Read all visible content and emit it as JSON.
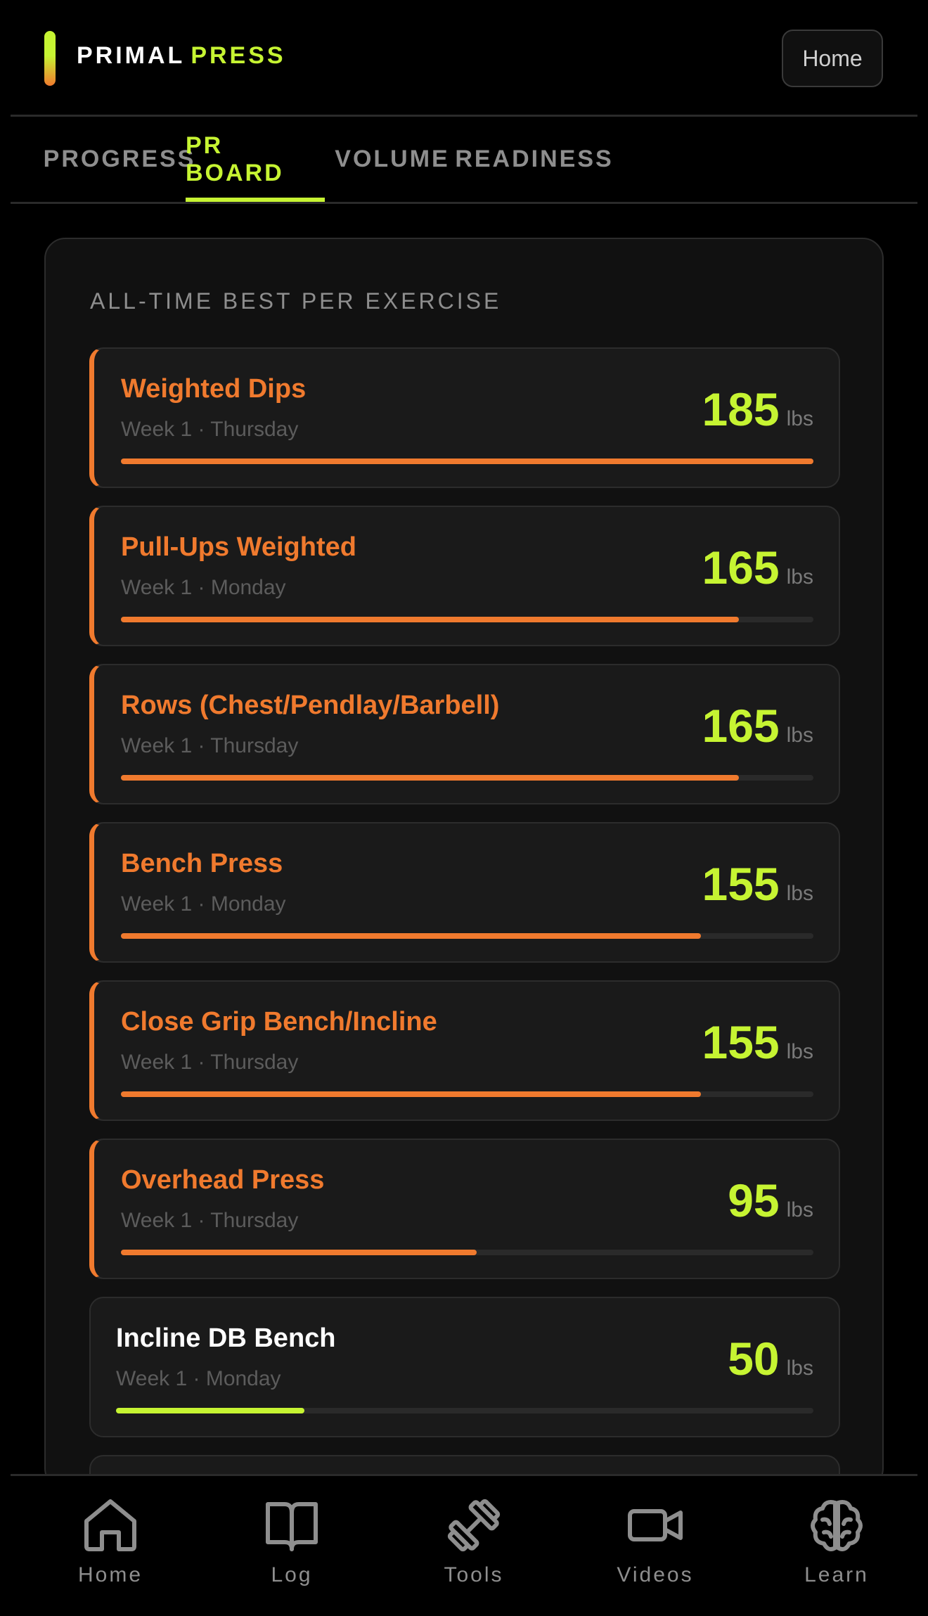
{
  "header": {
    "brand_word1": "PRIMAL",
    "brand_word2": "PRESS",
    "home_button": "Home"
  },
  "tabs": [
    {
      "label": "PROGRESS",
      "active": false
    },
    {
      "label": "PR BOARD",
      "active": true
    },
    {
      "label": "VOLUME",
      "active": false
    },
    {
      "label": "READINESS",
      "active": false
    }
  ],
  "board": {
    "title": "ALL-TIME BEST PER EXERCISE",
    "items": [
      {
        "name": "Weighted Dips",
        "meta": "Week 1 · Thursday",
        "value": "185",
        "unit": "lbs",
        "progress": 1.0,
        "highlight": true
      },
      {
        "name": "Pull-Ups Weighted",
        "meta": "Week 1 · Monday",
        "value": "165",
        "unit": "lbs",
        "progress": 0.892,
        "highlight": true
      },
      {
        "name": "Rows (Chest/Pendlay/Barbell)",
        "meta": "Week 1 · Thursday",
        "value": "165",
        "unit": "lbs",
        "progress": 0.892,
        "highlight": true
      },
      {
        "name": "Bench Press",
        "meta": "Week 1 · Monday",
        "value": "155",
        "unit": "lbs",
        "progress": 0.838,
        "highlight": true
      },
      {
        "name": "Close Grip Bench/Incline",
        "meta": "Week 1 · Thursday",
        "value": "155",
        "unit": "lbs",
        "progress": 0.838,
        "highlight": true
      },
      {
        "name": "Overhead Press",
        "meta": "Week 1 · Thursday",
        "value": "95",
        "unit": "lbs",
        "progress": 0.514,
        "highlight": true
      },
      {
        "name": "Incline DB Bench",
        "meta": "Week 1 · Monday",
        "value": "50",
        "unit": "lbs",
        "progress": 0.27,
        "highlight": false
      },
      {
        "name": "",
        "meta": "",
        "value": "",
        "unit": "",
        "progress": 0,
        "highlight": false
      }
    ]
  },
  "nav": [
    {
      "label": "Home",
      "icon": "home-icon"
    },
    {
      "label": "Log",
      "icon": "book-icon"
    },
    {
      "label": "Tools",
      "icon": "dumbbell-icon"
    },
    {
      "label": "Videos",
      "icon": "video-camera-icon"
    },
    {
      "label": "Learn",
      "icon": "brain-icon"
    }
  ],
  "colors": {
    "accent": "#c6f432",
    "highlight": "#f07a2e",
    "background": "#000000",
    "card": "#111111"
  }
}
